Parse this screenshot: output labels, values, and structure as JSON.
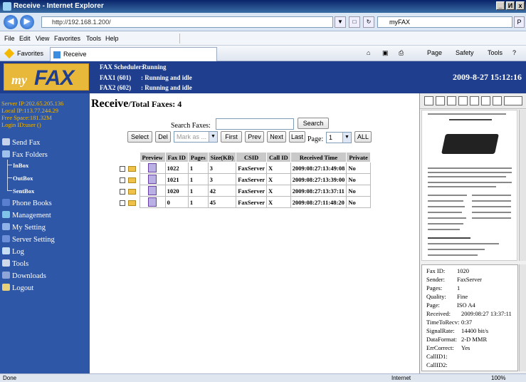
{
  "window": {
    "title": "Receive - Internet Explorer",
    "buttons": [
      "_",
      "И",
      "x"
    ]
  },
  "address": {
    "url": "http://192.168.1.200/",
    "search_value": "myFAX",
    "search_go": "P"
  },
  "menu": [
    "File",
    "Edit",
    "View",
    "Favorites",
    "Tools",
    "Help"
  ],
  "favbar": {
    "favorites": "Favorites",
    "tab_title": "Receive",
    "page": "Page",
    "safety": "Safety",
    "tools": "Tools"
  },
  "header": {
    "logo_my": "my",
    "logo_fax": "FAX",
    "scheduler_label": "FAX Scheduler:",
    "scheduler_value": "Running",
    "fax1_label": "FAX1 (601)",
    "fax1_value": ": Running and idle",
    "fax2_label": "FAX2 (602)",
    "fax2_value": ": Running and idle",
    "datetime": "2009-8-27 15:12:16"
  },
  "sysinfo": {
    "server_ip": "Server IP:202.65.205.136",
    "local_ip": "Local IP:113.77.244.29",
    "free_space": "Free Space:181.32M",
    "login": "Login ID:user ()"
  },
  "nav": {
    "send_fax": "Send Fax",
    "fax_folders": "Fax Folders",
    "inbox": "InBox",
    "outbox": "OutBox",
    "sentbox": "SentBox",
    "phone_books": "Phone Books",
    "management": "Management",
    "my_setting": "My Setting",
    "server_setting": "Server Setting",
    "log": "Log",
    "tools": "Tools",
    "downloads": "Downloads",
    "logout": "Logout"
  },
  "main": {
    "title": "Receive",
    "subtitle": "/Total Faxes: 4",
    "search_label": "Search Faxes:",
    "search_button": "Search",
    "select_button": "Select",
    "del_button": "Del",
    "mark_as": "Mark as ...",
    "first": "First",
    "prev": "Prev",
    "next": "Next",
    "last": "Last",
    "page_label": "Page:",
    "page_value": "1",
    "all": "ALL"
  },
  "table": {
    "headers": [
      "",
      "",
      "Preview",
      "Fax ID",
      "Pages",
      "Size(KB)",
      "CSID",
      "Call ID",
      "Received Time",
      "Private"
    ],
    "rows": [
      {
        "fax_id": "1022",
        "pages": "1",
        "size": "3",
        "csid": "FaxServer",
        "call_id": "X",
        "time": "2009:08:27:13:49:08",
        "private": "No"
      },
      {
        "fax_id": "1021",
        "pages": "1",
        "size": "3",
        "csid": "FaxServer",
        "call_id": "X",
        "time": "2009:08:27:13:39:00",
        "private": "No"
      },
      {
        "fax_id": "1020",
        "pages": "1",
        "size": "42",
        "csid": "FaxServer",
        "call_id": "X",
        "time": "2009:08:27:13:37:11",
        "private": "No"
      },
      {
        "fax_id": "0",
        "pages": "1",
        "size": "45",
        "csid": "FaxServer",
        "call_id": "X",
        "time": "2009:08:27:11:48:20",
        "private": "No"
      }
    ]
  },
  "details": {
    "fax_id": {
      "label": "Fax ID:",
      "value": "1020"
    },
    "sender": {
      "label": "Sender:",
      "value": "FaxServer"
    },
    "pages": {
      "label": "Pages:",
      "value": "1"
    },
    "quality": {
      "label": "Quality:",
      "value": "Fine"
    },
    "page": {
      "label": "Page:",
      "value": "ISO A4"
    },
    "received": {
      "label": "Received:",
      "value": "2009:08:27 13:37:11"
    },
    "time_to_recv": {
      "label": "TimeToRecv:",
      "value": "0:37"
    },
    "signal_rate": {
      "label": "SignalRate:",
      "value": "14400 bit/s"
    },
    "data_format": {
      "label": "DataFormat:",
      "value": "2-D MMR"
    },
    "err_correct": {
      "label": "ErrCorrect:",
      "value": "Yes"
    },
    "call_id1": {
      "label": "CallID1:",
      "value": ""
    },
    "call_id2": {
      "label": "CallID2:",
      "value": ""
    }
  },
  "statusbar": {
    "left": "Done",
    "zone": "Internet",
    "zoom": "100%"
  },
  "colors": {
    "banner": "#1f3f8e",
    "sidebar": "#2f57a8",
    "sysinfo_text": "#f5b800",
    "logo_bg": "#e8b83a"
  }
}
